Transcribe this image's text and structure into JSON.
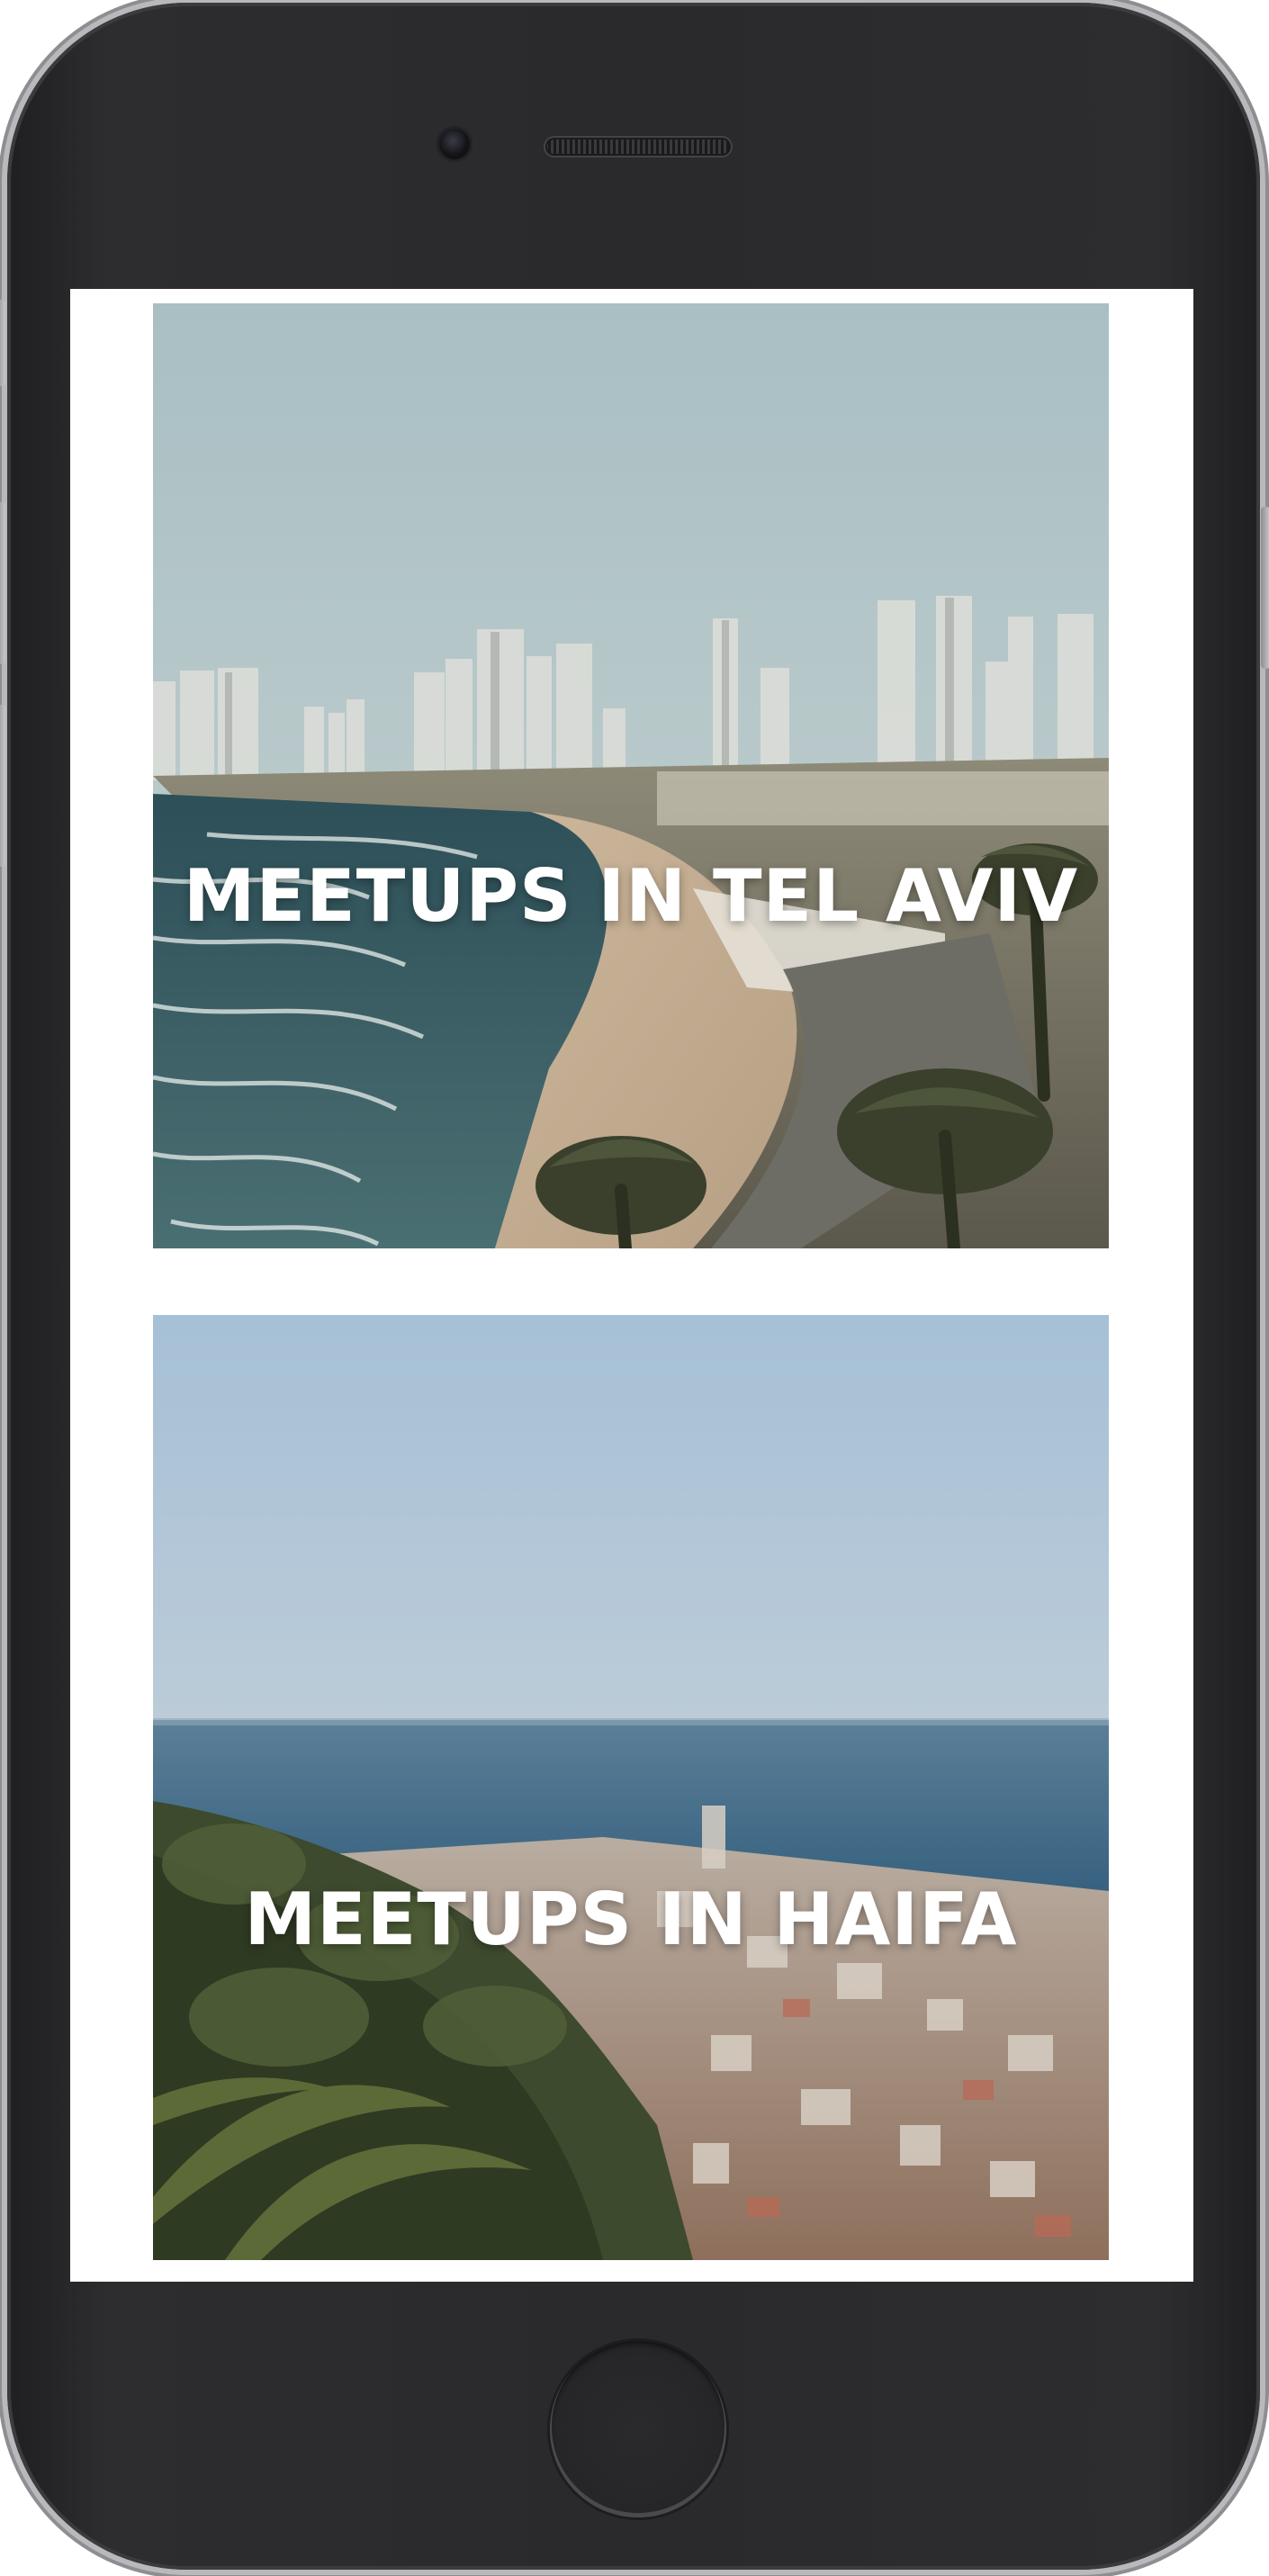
{
  "cards": [
    {
      "title": "MEETUPS IN TEL AVIV",
      "scene": "tel-aviv-beach-skyline"
    },
    {
      "title": "MEETUPS IN HAIFA",
      "scene": "haifa-bay-cityscape"
    }
  ],
  "colors": {
    "device_body": "#2a2a2c",
    "device_frame": "#b9b9bd",
    "screen_background": "#ffffff",
    "title_text": "#ffffff"
  }
}
